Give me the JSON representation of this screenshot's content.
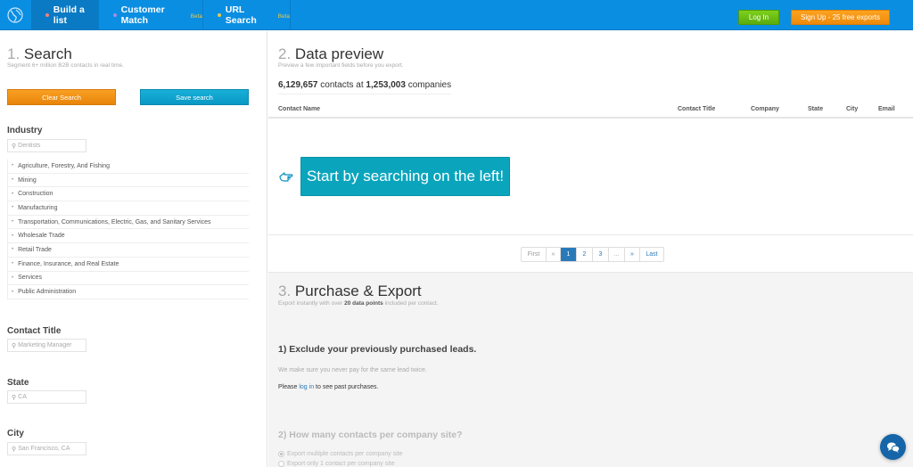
{
  "nav": {
    "logo_icon": "globe-logo-icon",
    "tabs": [
      {
        "label": "Build a list",
        "dot_color": "#f08080",
        "beta": null,
        "active": true
      },
      {
        "label": "Customer Match",
        "dot_color": "#a58ae8",
        "beta": "Beta",
        "active": false
      },
      {
        "label": "URL Search",
        "dot_color": "#e8c84a",
        "beta": "Beta",
        "active": false
      }
    ],
    "login_label": "Log In",
    "signup_label": "Sign Up - 25 free exports"
  },
  "search": {
    "number": "1.",
    "title": "Search",
    "subtitle": "Segment 6+ million B2B contacts in real time.",
    "clear_label": "Clear Search",
    "save_label": "Save search",
    "industry": {
      "label": "Industry",
      "placeholder": "Dentists",
      "items": [
        "Agriculture, Forestry, And Fishing",
        "Mining",
        "Construction",
        "Manufacturing",
        "Transportation, Communications, Electric, Gas, and Sanitary Services",
        "Wholesale Trade",
        "Retail Trade",
        "Finance, Insurance, and Real Estate",
        "Services",
        "Public Administration"
      ]
    },
    "contact_title": {
      "label": "Contact Title",
      "placeholder": "Marketing Manager"
    },
    "state": {
      "label": "State",
      "placeholder": "CA"
    },
    "city": {
      "label": "City",
      "placeholder": "San Francisco, CA"
    }
  },
  "preview": {
    "number": "2.",
    "title": "Data preview",
    "subtitle": "Preview a few important fields before you export.",
    "contacts_count": "6,129,657",
    "contacts_text": "contacts at",
    "companies_count": "1,253,003",
    "companies_text": "companies",
    "columns": [
      "Contact Name",
      "Contact Title",
      "Company",
      "State",
      "City",
      "Email"
    ],
    "cta_label": "Start by searching on the left!",
    "pagination": {
      "pages": [
        "First",
        "«",
        "1",
        "2",
        "3",
        "...",
        "»",
        "Last"
      ],
      "current": "1"
    }
  },
  "purchase": {
    "number": "3.",
    "title": "Purchase & Export",
    "subtitle_pre": "Export instantly with over",
    "subtitle_bold": "20 data points",
    "subtitle_post": "included per contact.",
    "step1_title": "1) Exclude your previously purchased leads.",
    "step1_note": "We make sure you never pay for the same lead twice.",
    "step1_login_pre": "Please",
    "step1_login_link": "log in",
    "step1_login_post": "to see past purchases.",
    "step2_title": "2) How many contacts per company site?",
    "step2_options": [
      {
        "label": "Export multiple contacts per company site",
        "checked": true
      },
      {
        "label": "Export only 1 contact per company site",
        "checked": false
      }
    ]
  },
  "chat": {
    "icon": "chat-bubbles-icon"
  }
}
